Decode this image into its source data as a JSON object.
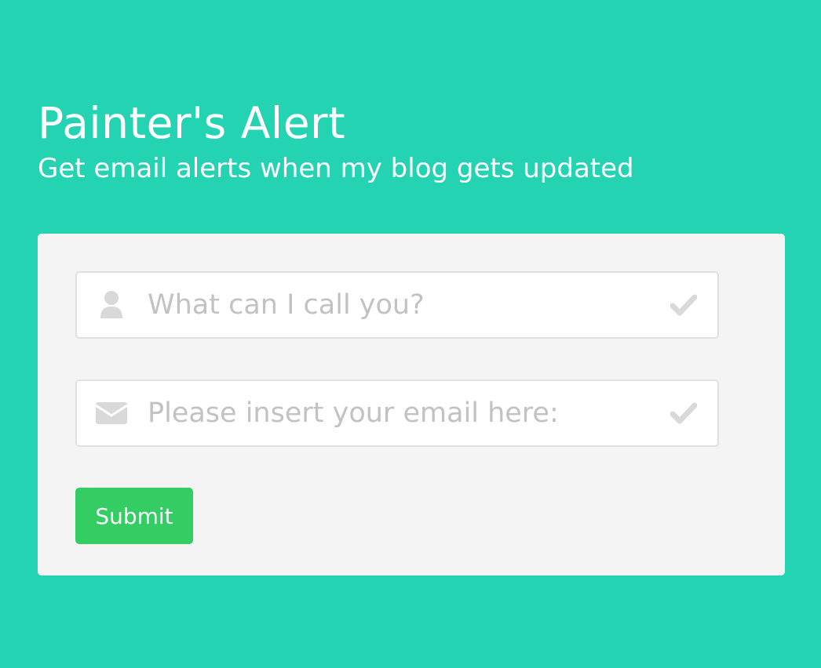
{
  "header": {
    "title": "Painter's Alert",
    "subtitle": "Get email alerts when my blog gets updated"
  },
  "form": {
    "name_field": {
      "placeholder": "What can I call you?",
      "icon": "user-icon",
      "status_icon": "check-icon"
    },
    "email_field": {
      "placeholder": "Please insert your email here:",
      "icon": "envelope-icon",
      "status_icon": "check-icon"
    },
    "submit_label": "Submit"
  },
  "colors": {
    "background": "#24d3b1",
    "card": "#f4f4f4",
    "submit": "#33cd63",
    "icon_muted": "#d9d9d9"
  }
}
